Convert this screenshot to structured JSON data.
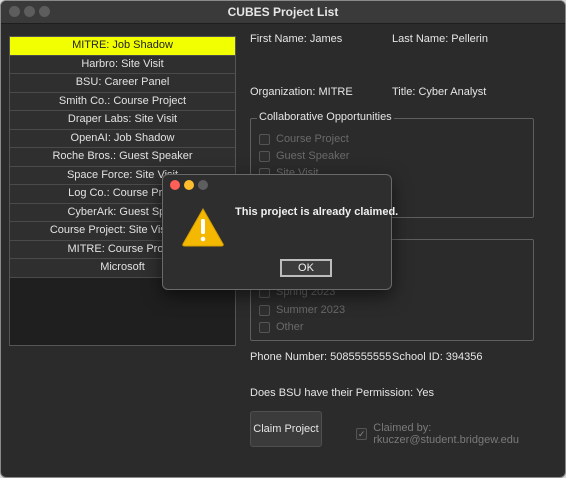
{
  "window": {
    "title": "CUBES Project List"
  },
  "projects": [
    "MITRE: Job Shadow",
    "Harbro: Site Visit",
    "BSU: Career Panel",
    "Smith Co.: Course Project",
    "Draper Labs: Site Visit",
    "OpenAI:  Job Shadow",
    "Roche Bros.: Guest Speaker",
    "Space Force: Site Visit",
    "Log Co.: Course Proje",
    "CyberArk: Guest Spea",
    "Course Project: Site Visit: Car",
    "MITRE: Course Projec",
    "Microsoft"
  ],
  "details": {
    "first_name": "First Name: James",
    "last_name": "Last Name: Pellerin",
    "organization": "Organization: MITRE",
    "title": "Title: Cyber Analyst",
    "phone": "Phone Number: 5085555555",
    "school_id": "School ID: 394356",
    "permission": "Does BSU have their Permission: Yes"
  },
  "collab": {
    "title": "Collaborative Opportunities",
    "options": [
      "Course Project",
      "Guest Speaker",
      "Site Visit"
    ]
  },
  "semesters": {
    "options": [
      "Spring 2023",
      "Summer 2023",
      "Other"
    ]
  },
  "claim_button": "Claim Project",
  "claimed_by": "Claimed by: rkuczer@student.bridgew.edu",
  "dialog": {
    "message": "This project is already claimed.",
    "ok_label": "OK"
  },
  "colors": {
    "selected_row": "#f2ff00",
    "warning": "#f5b800"
  }
}
